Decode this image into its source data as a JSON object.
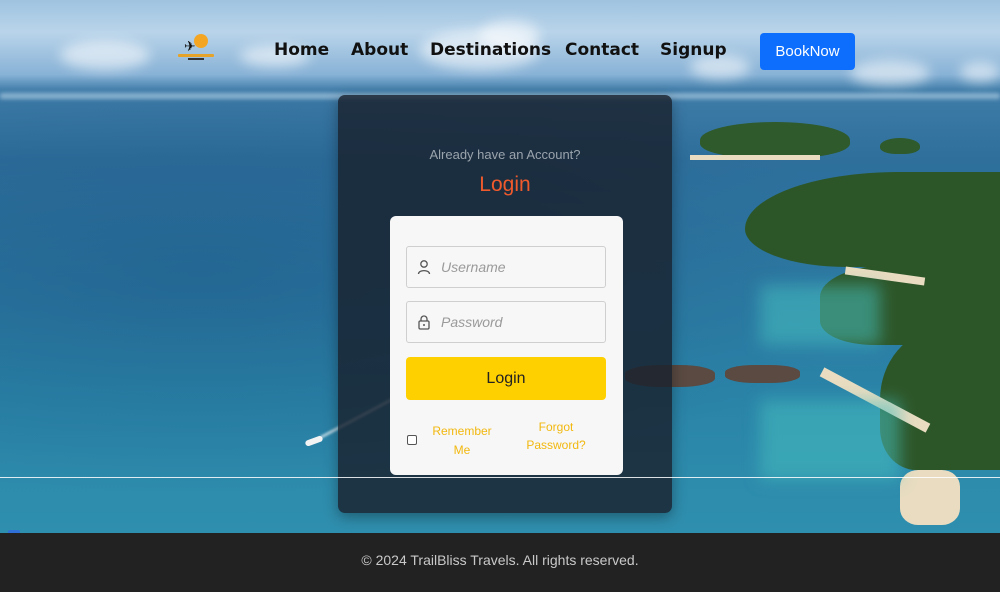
{
  "nav": {
    "links": [
      "Home",
      "About",
      "Destinations",
      "Contact",
      "Signup"
    ],
    "book_label": "BookNow"
  },
  "login": {
    "prompt": "Already have an Account?",
    "title": "Login",
    "username_placeholder": "Username",
    "password_placeholder": "Password",
    "submit_label": "Login",
    "remember_label": "Remember Me",
    "forgot_label": "Forgot Password?"
  },
  "footer": {
    "text": "© 2024 TrailBliss Travels. All rights reserved."
  },
  "colors": {
    "accent_orange": "#ef5a2c",
    "button_yellow": "#ffd000",
    "link_yellow": "#f2b80f",
    "book_blue": "#0d6efd",
    "footer_bg": "#222222"
  },
  "icons": [
    "logo-plane-icon",
    "user-icon",
    "lock-icon",
    "widget-icon"
  ]
}
